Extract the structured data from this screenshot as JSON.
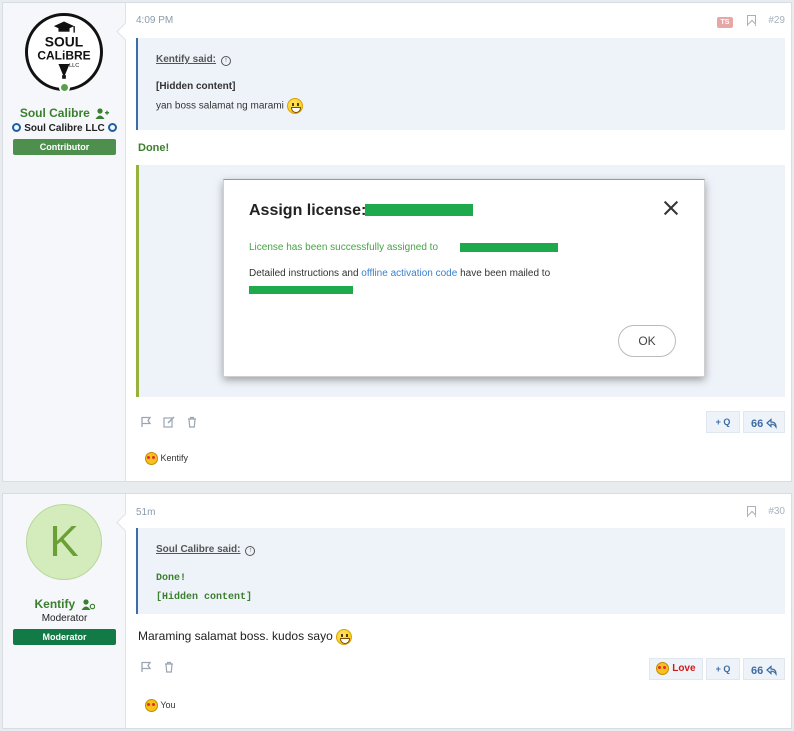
{
  "posts": [
    {
      "user": {
        "name": "Soul Calibre",
        "title": "Soul Calibre LLC",
        "banner": "Contributor",
        "logo_text": {
          "line1": "SOUL",
          "line2": "CALiBRE",
          "line3": "LLC"
        }
      },
      "time": "4:09 PM",
      "badge": "TS",
      "number": "#29",
      "quote": {
        "author": "Kentify said:",
        "lines": [
          "[Hidden content]",
          "yan boss salamat ng marami"
        ]
      },
      "body": "Done!",
      "dialog": {
        "title": "Assign license:",
        "success": "License has been successfully assigned to",
        "detail_before": "Detailed instructions and",
        "detail_link": "offline activation code",
        "detail_after": "have been mailed to",
        "ok": "OK"
      },
      "buttons": {
        "quote": "+ Q"
      },
      "reaction": "Kentify"
    },
    {
      "user": {
        "name": "Kentify",
        "avatar_letter": "K",
        "title": "Moderator",
        "banner": "Moderator"
      },
      "time": "51m",
      "number": "#30",
      "quote": {
        "author": "Soul Calibre said:",
        "lines": [
          "Done!",
          "[Hidden content]"
        ]
      },
      "body": "Maraming salamat boss. kudos sayo",
      "buttons": {
        "love": "Love",
        "quote": "+ Q"
      },
      "reaction": "You"
    }
  ],
  "colors": {
    "username": "#3b7f2e",
    "contributor": "#4f8f4e",
    "moderator": "#127a47",
    "quote_border": "#3d6da3",
    "redaction": "#1ea94c"
  }
}
